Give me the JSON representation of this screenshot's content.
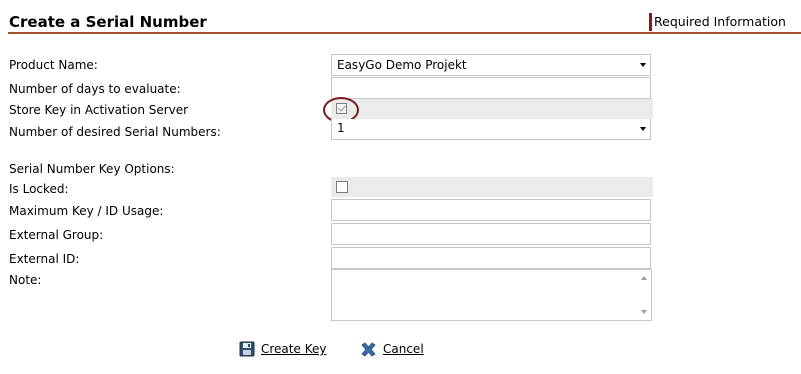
{
  "header": {
    "title": "Create a Serial Number",
    "required_info": "Required Information"
  },
  "form": {
    "product_name_label": "Product Name:",
    "product_name_value": "EasyGo Demo Projekt",
    "days_label": "Number of days to evaluate:",
    "days_value": "",
    "store_key_label": "Store Key in Activation Server",
    "store_key_checked": true,
    "num_serials_label": "Number of desired Serial Numbers:",
    "num_serials_value": "1",
    "options_heading": "Serial Number Key Options:",
    "is_locked_label": "Is Locked:",
    "is_locked_checked": false,
    "max_usage_label": "Maximum Key / ID Usage:",
    "max_usage_value": "",
    "external_group_label": "External Group:",
    "external_group_value": "",
    "external_id_label": "External ID:",
    "external_id_value": "",
    "note_label": "Note:",
    "note_value": ""
  },
  "actions": {
    "create_label": "Create Key",
    "create_icon": "save-icon",
    "cancel_label": "Cancel",
    "cancel_icon": "close-icon"
  },
  "colors": {
    "accent": "#8b1a1a",
    "divider": "#a0522d",
    "gray_row": "#ebebeb"
  }
}
